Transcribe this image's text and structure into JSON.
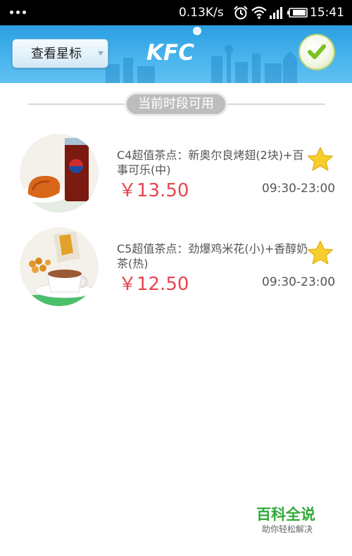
{
  "status_bar": {
    "network_speed": "0.13K/s",
    "time": "15:41"
  },
  "header": {
    "star_button_label": "查看星标",
    "logo_text": "KFC"
  },
  "section": {
    "label": "当前时段可用"
  },
  "items": [
    {
      "title": "C4超值茶点：新奥尔良烤翅(2块)+百事可乐(中)",
      "price": "￥13.50",
      "hours": "09:30-23:00"
    },
    {
      "title": "C5超值茶点：劲爆鸡米花(小)+香醇奶茶(热)",
      "price": "￥12.50",
      "hours": "09:30-23:00"
    }
  ],
  "watermark": {
    "title": "百科全说",
    "subtitle": "助你轻松解决"
  },
  "colors": {
    "header_blue": "#2b9fe2",
    "price_red": "#e8444f",
    "star_yellow": "#f7cf2d",
    "check_green": "#7cc122",
    "watermark_green": "#31a93a"
  }
}
